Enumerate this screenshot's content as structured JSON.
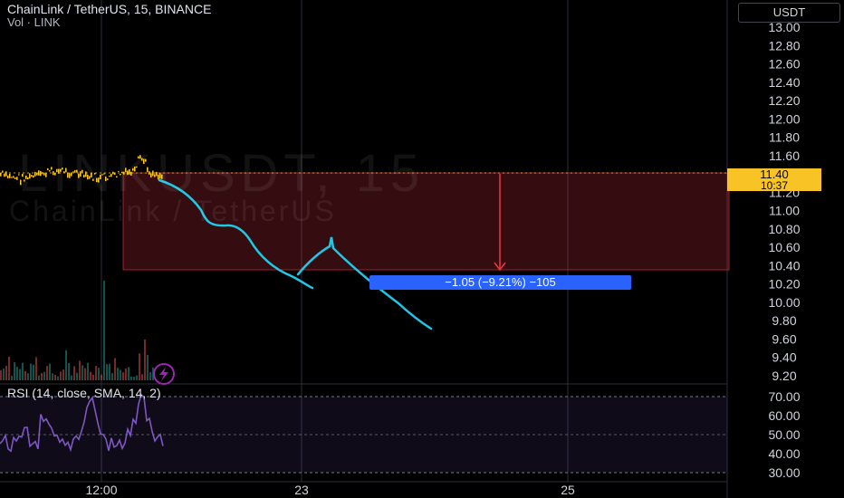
{
  "header": {
    "title": "ChainLink / TetherUS, 15, BINANCE",
    "volume": "Vol · LINK"
  },
  "watermark": {
    "symbol": "LINKUSDT, 15",
    "description": "ChainLink / TetherUS"
  },
  "currency_button": "USDT",
  "price_axis": {
    "labels": [
      "13.00",
      "12.80",
      "12.60",
      "12.40",
      "12.20",
      "12.00",
      "11.80",
      "11.60",
      "11.20",
      "11.00",
      "10.80",
      "10.60",
      "10.40",
      "10.20",
      "10.00",
      "9.80",
      "9.60",
      "9.40",
      "9.20"
    ]
  },
  "last_price": {
    "value": "11.40",
    "countdown": "10:37"
  },
  "time_axis": {
    "labels": [
      "12:00",
      "23",
      "25"
    ]
  },
  "measure": {
    "label": "−1.05 (−9.21%) −105"
  },
  "rsi": {
    "legend": "RSI (14, close, SMA, 14, 2)",
    "axis_labels": [
      "70.00",
      "60.00",
      "50.00",
      "40.00",
      "30.00"
    ]
  },
  "colors": {
    "background": "#000000",
    "candle": "#f7c325",
    "rsi_line": "#7e57c2",
    "rsi_band": "#7e57c2",
    "measure_zone": "#f23645",
    "measure_label": "#2962ff",
    "drawing": "#1ec8e6",
    "grid": "#2a2e39"
  },
  "icons": {
    "indicator_badge": "lightning-icon"
  }
}
